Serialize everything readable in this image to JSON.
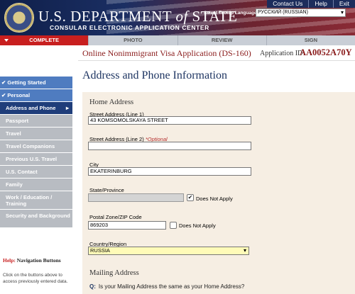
{
  "header": {
    "title_main": "U.S. DEPARTMENT",
    "title_of": "of",
    "title_end": "STATE",
    "subtitle": "CONSULAR ELECTRONIC APPLICATION CENTER",
    "links": [
      "Contact Us",
      "Help",
      "Exit"
    ],
    "language_label": "Select Tooltip Language",
    "language_value": "РУССКИЙ (RUSSIAN)"
  },
  "progress": {
    "steps": [
      "COMPLETE",
      "PHOTO",
      "REVIEW",
      "SIGN"
    ],
    "active_index": 0
  },
  "app": {
    "title": "Online Nonimmigrant Visa Application (DS-160)",
    "id_label": "Application ID",
    "id_value": "AA0052A70Y"
  },
  "sidebar": {
    "items": [
      {
        "label": "✔ Getting Started",
        "state": "done"
      },
      {
        "label": "✔ Personal",
        "state": "done"
      },
      {
        "label": "Address and Phone",
        "state": "current"
      },
      {
        "label": "Passport",
        "state": "todo"
      },
      {
        "label": "Travel",
        "state": "todo"
      },
      {
        "label": "Travel Companions",
        "state": "todo"
      },
      {
        "label": "Previous U.S. Travel",
        "state": "todo"
      },
      {
        "label": "U.S. Contact",
        "state": "todo"
      },
      {
        "label": "Family",
        "state": "todo"
      },
      {
        "label": "Work / Education / Training",
        "state": "todo"
      },
      {
        "label": "Security and Background",
        "state": "todo"
      }
    ],
    "help_prefix": "Help:",
    "help_title": "Navigation Buttons",
    "help_text": "Click on the buttons above to access previously entered data."
  },
  "main": {
    "page_title": "Address and Phone Information",
    "home_address_title": "Home Address",
    "street1_label": "Street Address (Line 1)",
    "street1_value": "43 KOMSOMOLSKAYA STREET",
    "street2_label": "Street Address (Line 2)",
    "street2_optional": "*Optional",
    "street2_value": "",
    "city_label": "City",
    "city_value": "EKATERINBURG",
    "state_label": "State/Province",
    "state_value": "",
    "state_na_label": "Does Not Apply",
    "state_na_checked": true,
    "zip_label": "Postal Zone/ZIP Code",
    "zip_value": "869203",
    "zip_na_label": "Does Not Apply",
    "zip_na_checked": false,
    "country_label": "Country/Region",
    "country_value": "RUSSIA",
    "mailing_title": "Mailing Address",
    "question_prefix": "Q:",
    "question_text": "Is your Mailing Address the same as your Home Address?"
  }
}
